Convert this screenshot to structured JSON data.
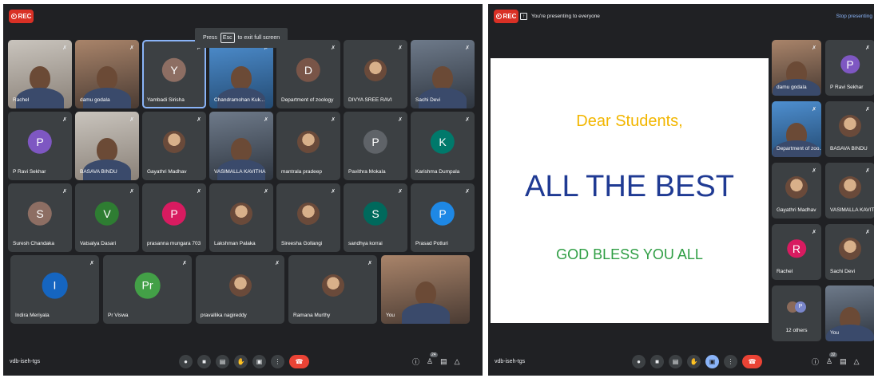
{
  "rec_label": "REC",
  "left": {
    "tooltip": {
      "before": "Press",
      "key": "Esc",
      "after": "to exit full screen"
    },
    "meeting_code": "vdb-iseh-tgs",
    "people_count": "24",
    "tiles": [
      {
        "name": "Rachel",
        "kind": "video"
      },
      {
        "name": "damu godala",
        "kind": "video"
      },
      {
        "name": "Yambadi Sirisha",
        "kind": "avatar",
        "letter": "Y",
        "color": "#8d6e63"
      },
      {
        "name": "Chandramohan Kuk...",
        "kind": "video"
      },
      {
        "name": "Department of zoology",
        "kind": "avatar",
        "letter": "D",
        "color": "#795548"
      },
      {
        "name": "DIVYA SREE RAVI",
        "kind": "photo"
      },
      {
        "name": "Sachi Devi",
        "kind": "video"
      },
      {
        "name": "P Ravi Sekhar",
        "kind": "avatar",
        "letter": "P",
        "color": "#7e57c2"
      },
      {
        "name": "BASAVA BINDU",
        "kind": "video"
      },
      {
        "name": "Gayathri Madhav",
        "kind": "photo"
      },
      {
        "name": "VASIMALLA KAVITHA",
        "kind": "video"
      },
      {
        "name": "mantrala pradeep",
        "kind": "photo"
      },
      {
        "name": "Pavithra Mokala",
        "kind": "avatar",
        "letter": "P",
        "color": "#5f6368"
      },
      {
        "name": "Karishma Dumpala",
        "kind": "avatar",
        "letter": "K",
        "color": "#00796b"
      },
      {
        "name": "Suresh Chandaka",
        "kind": "avatar",
        "letter": "S",
        "color": "#8d6e63"
      },
      {
        "name": "Vatsalya Dasari",
        "kind": "avatar",
        "letter": "V",
        "color": "#2e7d32"
      },
      {
        "name": "prasanna mungara 703",
        "kind": "avatar",
        "letter": "P",
        "color": "#d81b60"
      },
      {
        "name": "Lakshman Palaka",
        "kind": "photo"
      },
      {
        "name": "Sireesha Gollangi",
        "kind": "photo"
      },
      {
        "name": "sandhya korrai",
        "kind": "avatar",
        "letter": "S",
        "color": "#00695c"
      },
      {
        "name": "Prasad Potluri",
        "kind": "avatar",
        "letter": "P",
        "color": "#1e88e5"
      },
      {
        "name": "Indira Meriyala",
        "kind": "avatar",
        "letter": "I",
        "color": "#1565c0"
      },
      {
        "name": "Pr Viswa",
        "kind": "avatar",
        "letter": "Pr",
        "color": "#43a047"
      },
      {
        "name": "pravallika nagireddy",
        "kind": "photo"
      },
      {
        "name": "Ramana Murthy",
        "kind": "photo"
      },
      {
        "name": "You",
        "kind": "video"
      }
    ]
  },
  "right": {
    "presenting_text": "You're presenting to everyone",
    "stop_label": "Stop presenting",
    "meeting_code": "vdb-iseh-tgs",
    "people_count": "32",
    "slide": {
      "line1": "Dear Students,",
      "line2": "ALL THE BEST",
      "line3": "GOD BLESS YOU ALL"
    },
    "tiles": [
      {
        "name": "damu godala",
        "kind": "video"
      },
      {
        "name": "P Ravi Sekhar",
        "kind": "avatar",
        "letter": "P",
        "color": "#7e57c2"
      },
      {
        "name": "Department of zoo...",
        "kind": "video"
      },
      {
        "name": "BASAVA BINDU",
        "kind": "photo"
      },
      {
        "name": "Gayathri Madhav",
        "kind": "photo"
      },
      {
        "name": "VASIMALLA KAVITHA",
        "kind": "photo"
      },
      {
        "name": "Rachel",
        "kind": "avatar",
        "letter": "R",
        "color": "#d81b60"
      },
      {
        "name": "Sachi Devi",
        "kind": "photo"
      },
      {
        "name": "12 others",
        "kind": "others",
        "letter": "P"
      },
      {
        "name": "You",
        "kind": "video"
      }
    ]
  },
  "colors": {
    "accent": "#8ab4f8",
    "end_call": "#ea4335",
    "background": "#202124",
    "tile": "#3c4043"
  }
}
